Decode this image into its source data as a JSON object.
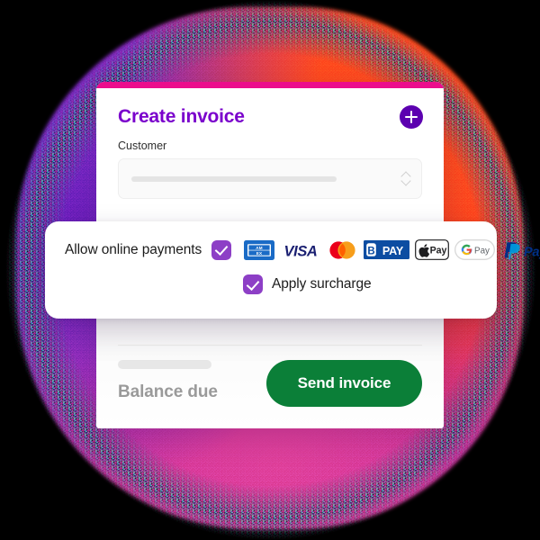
{
  "background": {
    "blob_colors": [
      "#7a2bc9",
      "#c4249f",
      "#e0409b",
      "#ff4a1e"
    ],
    "canvas_color": "#000000"
  },
  "card": {
    "accent_bar_color": "#ec0d8c",
    "title": "Create invoice",
    "title_color": "#7a00cc",
    "add_button": {
      "icon": "plus-icon",
      "color": "#5c00b0",
      "label": "Add"
    },
    "customer": {
      "label": "Customer",
      "value": "",
      "placeholder": "",
      "chevron_icon": "chevron-updown-icon"
    },
    "footer": {
      "balance_label": "Balance due",
      "balance_value": "",
      "send_button_label": "Send invoice",
      "send_button_color": "#0b7f38"
    }
  },
  "payments_panel": {
    "allow_label": "Allow online payments",
    "allow_checked": true,
    "surcharge_label": "Apply surcharge",
    "surcharge_checked": true,
    "checkbox_color": "#8d3fc6",
    "logos": [
      {
        "name": "amex-logo",
        "text": "AMEX"
      },
      {
        "name": "visa-logo",
        "text": "VISA"
      },
      {
        "name": "mastercard-logo",
        "text": "Mastercard"
      },
      {
        "name": "bpay-logo",
        "text": "BPAY"
      },
      {
        "name": "apple-pay-logo",
        "text": "Pay"
      },
      {
        "name": "google-pay-logo",
        "text": "G Pay"
      },
      {
        "name": "paypal-logo",
        "text": "PayPal"
      }
    ]
  }
}
